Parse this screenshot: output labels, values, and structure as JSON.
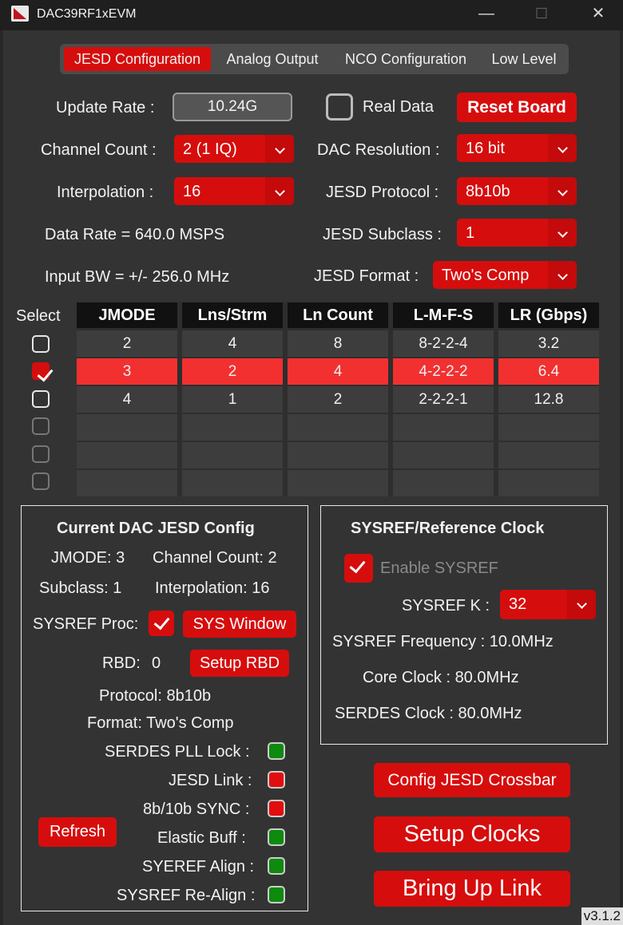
{
  "window": {
    "title": "DAC39RF1xEVM",
    "minimize": "—",
    "maximize": "☐",
    "close": "✕"
  },
  "tabs": [
    "JESD Configuration",
    "Analog Output",
    "NCO Configuration",
    "Low Level"
  ],
  "config": {
    "update_rate_label": "Update Rate :",
    "update_rate_value": "10.24G",
    "real_data_label": "Real Data",
    "reset_board": "Reset Board",
    "channel_count_label": "Channel Count :",
    "channel_count_value": "2 (1 IQ)",
    "dac_resolution_label": "DAC Resolution :",
    "dac_resolution_value": "16 bit",
    "interpolation_label": "Interpolation :",
    "interpolation_value": "16",
    "jesd_protocol_label": "JESD Protocol :",
    "jesd_protocol_value": "8b10b",
    "data_rate": "Data Rate = 640.0 MSPS",
    "jesd_subclass_label": "JESD Subclass :",
    "jesd_subclass_value": "1",
    "input_bw": "Input BW = +/- 256.0 MHz",
    "jesd_format_label": "JESD Format :",
    "jesd_format_value": "Two's Comp"
  },
  "table": {
    "select_label": "Select",
    "headers": [
      "JMODE",
      "Lns/Strm",
      "Ln Count",
      "L-M-F-S",
      "LR (Gbps)"
    ],
    "rows": [
      [
        "2",
        "4",
        "8",
        "8-2-2-4",
        "3.2"
      ],
      [
        "3",
        "2",
        "4",
        "4-2-2-2",
        "6.4"
      ],
      [
        "4",
        "1",
        "2",
        "2-2-2-1",
        "12.8"
      ],
      [
        "",
        "",
        "",
        "",
        ""
      ],
      [
        "",
        "",
        "",
        "",
        ""
      ],
      [
        "",
        "",
        "",
        "",
        ""
      ]
    ],
    "selected_row": 2
  },
  "current": {
    "title": "Current DAC JESD Config",
    "jmode": "JMODE: 3",
    "channel_count": "Channel Count: 2",
    "subclass": "Subclass: 1",
    "interpolation": "Interpolation: 16",
    "sysref_proc": "SYSREF Proc:",
    "sys_window": "SYS Window",
    "rbd_label": "RBD:",
    "rbd_value": "0",
    "setup_rbd": "Setup RBD",
    "protocol": "Protocol: 8b10b",
    "format": "Format: Two's Comp",
    "refresh": "Refresh",
    "status": [
      {
        "label": "SERDES PLL Lock :",
        "state": "green"
      },
      {
        "label": "JESD Link :",
        "state": "red"
      },
      {
        "label": "8b/10b SYNC :",
        "state": "red"
      },
      {
        "label": "Elastic Buff :",
        "state": "green"
      },
      {
        "label": "SYEREF Align :",
        "state": "green"
      },
      {
        "label": "SYSREF Re-Align :",
        "state": "green"
      }
    ]
  },
  "sysref": {
    "title": "SYSREF/Reference Clock",
    "enable_label": "Enable SYSREF",
    "k_label": "SYSREF K :",
    "k_value": "32",
    "frequency": "SYSREF Frequency : 10.0MHz",
    "core_clock": "Core Clock : 80.0MHz",
    "serdes_clock": "SERDES Clock : 80.0MHz"
  },
  "actions": {
    "crossbar": "Config JESD Crossbar",
    "setup_clocks": "Setup Clocks",
    "bring_up": "Bring Up Link"
  },
  "version": "v3.1.2",
  "colors": {
    "accent": "#d60d0d",
    "selected_row": "#f23030",
    "led_green": "#0e8a0e",
    "led_red": "#e20e0e"
  }
}
